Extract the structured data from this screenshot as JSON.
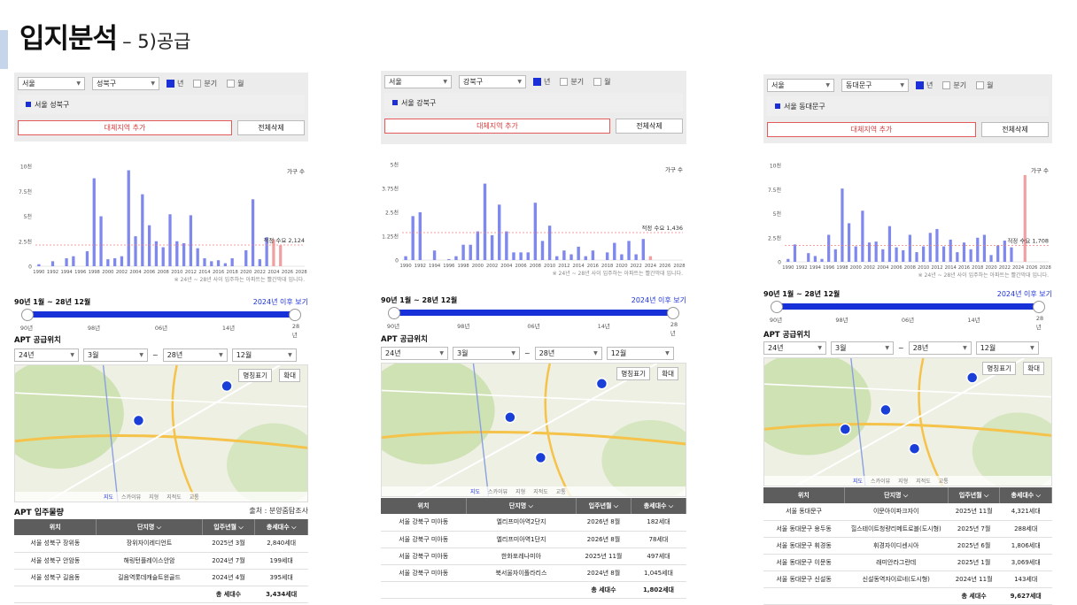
{
  "header": {
    "title": "입지분석",
    "subtitle": "– 5)공급"
  },
  "common": {
    "region_city": "서울",
    "freq": [
      "년",
      "분기",
      "월"
    ],
    "add_button": "대체지역 추가",
    "delete_button": "전체삭제",
    "unit_label": "가구 수",
    "note": "※ 24년 ~ 28년 사이 입주하는 아파트는 빨간막대 입니다.",
    "range_label": "90년 1월 ~ 28년 12월",
    "range_link": "2024년 이후 보기",
    "slider_ticks": [
      "90년",
      "98년",
      "06년",
      "14년",
      "28년"
    ],
    "apt_location_title": "APT 공급위치",
    "period": {
      "start_year": "24년",
      "start_month": "3월",
      "tilde": "~",
      "end_year": "28년",
      "end_month": "12월"
    },
    "map_buttons": [
      "명칭표기",
      "확대"
    ],
    "map_tabs": [
      "지도",
      "스카이뷰",
      "지형",
      "지적도",
      "교통"
    ],
    "table_headers": [
      "위치",
      "단지명 ⌵",
      "입주년월 ⌵",
      "총세대수 ⌵"
    ],
    "total_label": "총 세대수",
    "colors": {
      "bar": "#7f88ec",
      "bar_red": "#f0a0a0",
      "accent": "#1a2fd8"
    }
  },
  "panels": [
    {
      "district": "성북구",
      "legend": "서울 성북구",
      "chart_data": {
        "type": "bar",
        "title": "",
        "xlabel": "",
        "ylabel": "가구 수",
        "y_ticks": [
          "0",
          "2.5천",
          "5천",
          "7.5천",
          "10천"
        ],
        "ylim": [
          0,
          10000
        ],
        "x_tick_labels": [
          "1990",
          "1992",
          "1994",
          "1996",
          "1998",
          "2000",
          "2002",
          "2004",
          "2006",
          "2008",
          "2010",
          "2012",
          "2014",
          "2016",
          "2018",
          "2020",
          "2022",
          "2024",
          "2026",
          "2028"
        ],
        "x_start": 1990,
        "values": [
          200,
          0,
          500,
          0,
          800,
          1000,
          0,
          1500,
          8800,
          5000,
          700,
          800,
          1000,
          9600,
          3000,
          7200,
          4100,
          2500,
          1900,
          5200,
          2500,
          2300,
          5100,
          1800,
          800,
          500,
          600,
          300,
          800,
          0,
          1600,
          6700,
          700,
          2900,
          2700,
          2100,
          0,
          0,
          0
        ],
        "highlight_from": 2024,
        "threshold_value": 2124,
        "threshold_label": "적정 수요 2,124"
      },
      "source_title": "APT 입주물량",
      "source_text": "출처 : 분양줌탐조사",
      "table": [
        [
          "서울 성북구 장위동",
          "장위자이레디언트",
          "2025년 3월",
          "2,840세대"
        ],
        [
          "서울 성북구 안암동",
          "해링턴플레이스안암",
          "2024년 7월",
          "199세대"
        ],
        [
          "서울 성북구 길음동",
          "길음역롯데캐슬트윈골드",
          "2024년 4월",
          "395세대"
        ]
      ],
      "total": "3,434세대"
    },
    {
      "district": "강북구",
      "legend": "서울 강북구",
      "chart_data": {
        "type": "bar",
        "title": "",
        "xlabel": "",
        "ylabel": "가구 수",
        "y_ticks": [
          "0",
          "1.25천",
          "2.5천",
          "3.75천",
          "5천"
        ],
        "ylim": [
          0,
          5000
        ],
        "x_tick_labels": [
          "1990",
          "1992",
          "1994",
          "1996",
          "1998",
          "2000",
          "2002",
          "2004",
          "2006",
          "2008",
          "2010",
          "2012",
          "2014",
          "2016",
          "2018",
          "2020",
          "2022",
          "2024",
          "2026",
          "2028"
        ],
        "x_start": 1990,
        "values": [
          200,
          2300,
          2500,
          0,
          500,
          0,
          50,
          200,
          800,
          800,
          1500,
          4000,
          1300,
          2900,
          1500,
          400,
          400,
          400,
          3000,
          1000,
          1800,
          200,
          500,
          300,
          700,
          200,
          500,
          0,
          400,
          900,
          300,
          1000,
          300,
          1100,
          200,
          0,
          0,
          0,
          0
        ],
        "highlight_from": 2024,
        "threshold_value": 1436,
        "threshold_label": "적정 수요 1,436"
      },
      "table": [
        [
          "서울 강북구 미아동",
          "엘리프미아역2단지",
          "2026년 8월",
          "182세대"
        ],
        [
          "서울 강북구 미아동",
          "엘리프미아역1단지",
          "2026년 8월",
          "78세대"
        ],
        [
          "서울 강북구 미아동",
          "한화포레나미아",
          "2025년 11월",
          "497세대"
        ],
        [
          "서울 강북구 미아동",
          "북서울자이폴라리스",
          "2024년 8월",
          "1,045세대"
        ]
      ],
      "total": "1,802세대"
    },
    {
      "district": "동대문구",
      "legend": "서울 동대문구",
      "chart_data": {
        "type": "bar",
        "title": "",
        "xlabel": "",
        "ylabel": "가구 수",
        "y_ticks": [
          "0",
          "2.5천",
          "5천",
          "7.5천",
          "10천"
        ],
        "ylim": [
          0,
          10000
        ],
        "x_tick_labels": [
          "1990",
          "1992",
          "1994",
          "1996",
          "1998",
          "2000",
          "2002",
          "2004",
          "2006",
          "2008",
          "2010",
          "2012",
          "2014",
          "2016",
          "2018",
          "2020",
          "2022",
          "2024",
          "2026",
          "2028"
        ],
        "x_start": 1990,
        "values": [
          300,
          1800,
          0,
          900,
          600,
          300,
          2800,
          1300,
          7600,
          4000,
          1600,
          5300,
          2000,
          2100,
          1300,
          3700,
          1500,
          1200,
          2800,
          1000,
          1600,
          3000,
          3400,
          1600,
          2300,
          1000,
          2000,
          1300,
          2500,
          2800,
          700,
          1700,
          2200,
          1500,
          0,
          9000,
          0,
          0,
          0
        ],
        "highlight_from": 2024,
        "threshold_value": 1708,
        "threshold_label": "적정 수요 1,708"
      },
      "table": [
        [
          "서울 동대문구",
          "이문아이파크자이",
          "2025년 11월",
          "4,321세대"
        ],
        [
          "서울 동대문구 용두동",
          "힐스테이트청량리메트로블(도시형)",
          "2025년 7월",
          "288세대"
        ],
        [
          "서울 동대문구 휘경동",
          "휘경자이디센시아",
          "2025년 6월",
          "1,806세대"
        ],
        [
          "서울 동대문구 이문동",
          "래미안라그란데",
          "2025년 1월",
          "3,069세대"
        ],
        [
          "서울 동대문구 신설동",
          "신설동역자이르네(도시형)",
          "2024년 11월",
          "143세대"
        ]
      ],
      "total": "9,627세대"
    }
  ]
}
